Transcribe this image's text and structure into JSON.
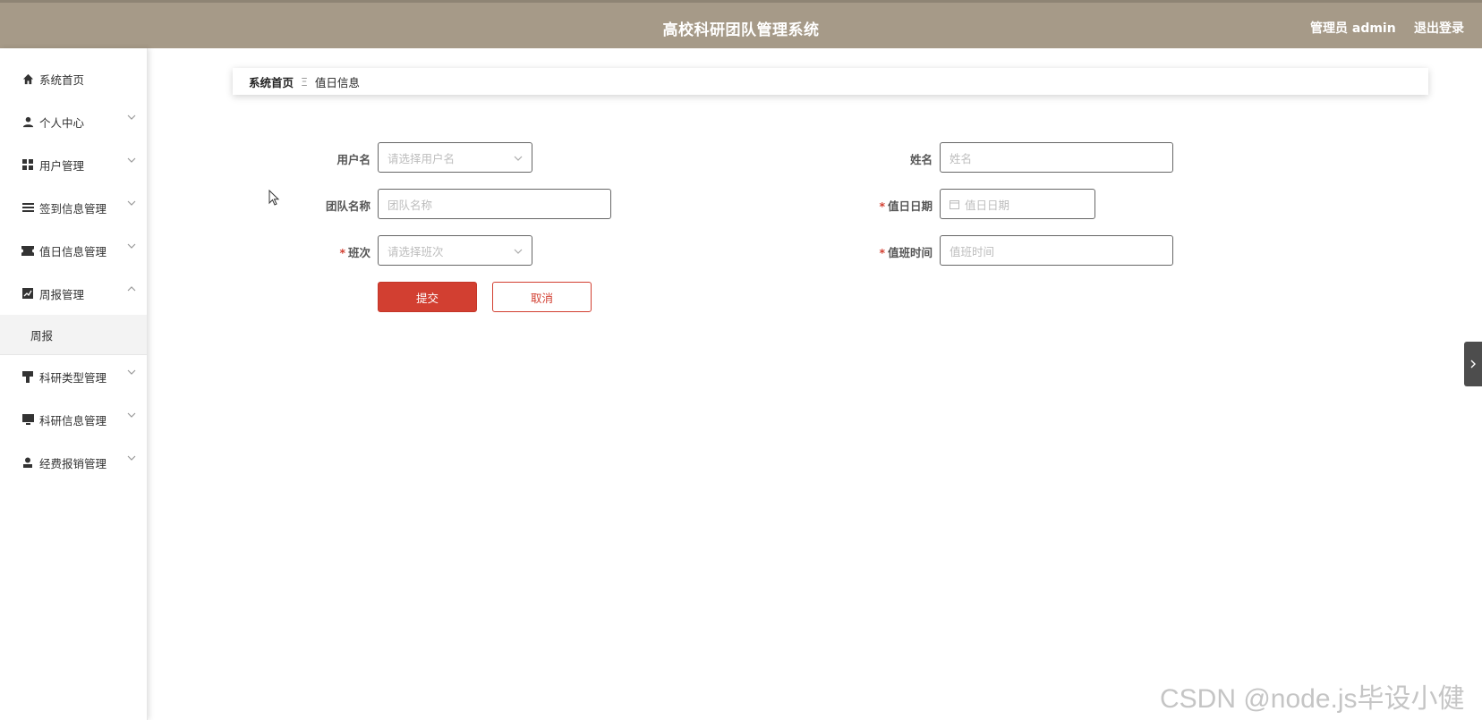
{
  "header": {
    "title": "高校科研团队管理系统",
    "user": "管理员 admin",
    "logout": "退出登录",
    "bg_color": "#a69a88"
  },
  "sidebar": {
    "items": [
      {
        "label": "系统首页",
        "icon": "home-icon",
        "chevron": "none"
      },
      {
        "label": "个人中心",
        "icon": "user-icon",
        "chevron": "down"
      },
      {
        "label": "用户管理",
        "icon": "grid-icon",
        "chevron": "down"
      },
      {
        "label": "签到信息管理",
        "icon": "list-icon",
        "chevron": "down"
      },
      {
        "label": "值日信息管理",
        "icon": "ticket-icon",
        "chevron": "down"
      },
      {
        "label": "周报管理",
        "icon": "chart-icon",
        "chevron": "up"
      },
      {
        "label": "科研类型管理",
        "icon": "brush-icon",
        "chevron": "down"
      },
      {
        "label": "科研信息管理",
        "icon": "monitor-icon",
        "chevron": "down"
      },
      {
        "label": "经费报销管理",
        "icon": "person-icon",
        "chevron": "down"
      }
    ],
    "submenu": {
      "label": "周报"
    }
  },
  "breadcrumb": {
    "home": "系统首页",
    "separator": "Ξ",
    "current": "值日信息"
  },
  "form": {
    "username": {
      "label": "用户名",
      "placeholder": "请选择用户名"
    },
    "name": {
      "label": "姓名",
      "placeholder": "姓名"
    },
    "team": {
      "label": "团队名称",
      "placeholder": "团队名称"
    },
    "duty_date": {
      "label": "值日日期",
      "placeholder": "值日日期",
      "required": "*"
    },
    "shift": {
      "label": "班次",
      "placeholder": "请选择班次",
      "required": "*"
    },
    "duty_time": {
      "label": "值班时间",
      "placeholder": "值班时间",
      "required": "*"
    },
    "submit": "提交",
    "cancel": "取消"
  },
  "colors": {
    "accent": "#d23f31"
  },
  "watermark": "CSDN @node.js毕设小健"
}
